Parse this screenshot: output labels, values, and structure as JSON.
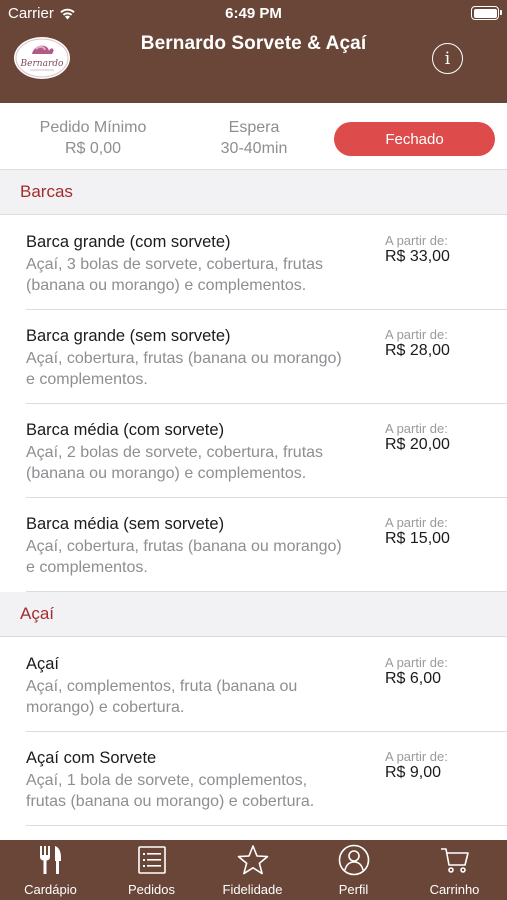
{
  "status_bar": {
    "carrier": "Carrier",
    "time": "6:49 PM"
  },
  "header": {
    "title": "Bernardo Sorvete & Açaí",
    "logo_text": "Bernardo",
    "info_icon": "info-icon"
  },
  "info_bar": {
    "min_label": "Pedido Mínimo",
    "min_value": "R$ 0,00",
    "wait_label": "Espera",
    "wait_value": "30-40min",
    "status": "Fechado",
    "status_color": "#dd4b4b"
  },
  "sections": [
    {
      "title": "Barcas",
      "items": [
        {
          "name": "Barca grande (com sorvete)",
          "desc_lines": [
            "Açaí, 3 bolas de sorvete, cobertura, frutas",
            "(banana ou morango) e complementos."
          ],
          "from_label": "A partir de:",
          "price": "R$ 33,00"
        },
        {
          "name": "Barca grande (sem sorvete)",
          "desc_lines": [
            "Açaí, cobertura, frutas (banana ou morango)",
            "e complementos."
          ],
          "from_label": "A partir de:",
          "price": "R$ 28,00"
        },
        {
          "name": "Barca média (com sorvete)",
          "desc_lines": [
            "Açaí, 2 bolas de sorvete, cobertura, frutas",
            "(banana ou morango) e complementos."
          ],
          "from_label": "A partir de:",
          "price": "R$ 20,00"
        },
        {
          "name": "Barca média (sem sorvete)",
          "desc_lines": [
            "Açaí, cobertura, frutas (banana ou morango)",
            "e complementos."
          ],
          "from_label": "A partir de:",
          "price": "R$ 15,00"
        }
      ]
    },
    {
      "title": "Açaí",
      "items": [
        {
          "name": "Açaí",
          "desc_lines": [
            "Açaí, complementos, fruta (banana ou",
            "morango) e cobertura."
          ],
          "from_label": "A partir de:",
          "price": "R$ 6,00"
        },
        {
          "name": "Açaí com Sorvete",
          "desc_lines": [
            "Açaí, 1 bola de sorvete, complementos,",
            "frutas (banana ou morango) e cobertura."
          ],
          "from_label": "A partir de:",
          "price": "R$ 9,00"
        }
      ]
    }
  ],
  "tabs": [
    {
      "label": "Cardápio",
      "icon": "fork-knife-icon"
    },
    {
      "label": "Pedidos",
      "icon": "list-icon"
    },
    {
      "label": "Fidelidade",
      "icon": "star-icon"
    },
    {
      "label": "Perfil",
      "icon": "person-icon"
    },
    {
      "label": "Carrinho",
      "icon": "cart-icon"
    }
  ],
  "colors": {
    "brand": "#6a4638",
    "accent": "#a52c2c",
    "closed": "#dd4b4b"
  }
}
